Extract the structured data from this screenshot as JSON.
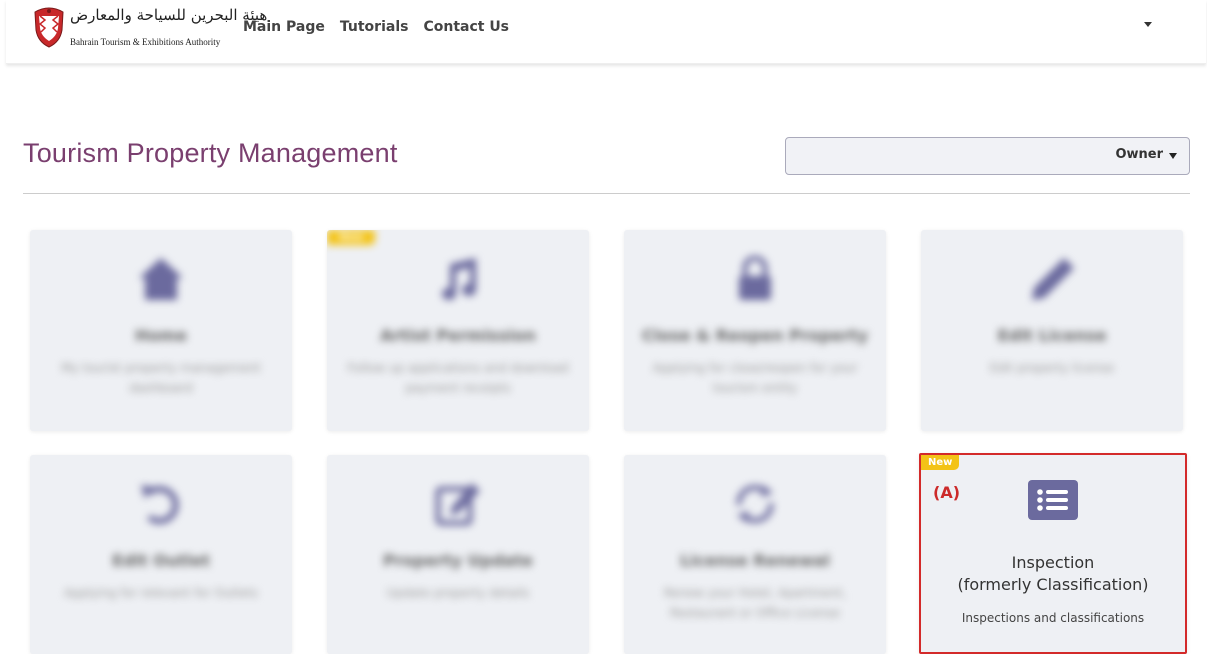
{
  "navbar": {
    "logo_arabic": "هيئة البحرين للسياحة والمعارض",
    "logo_english": "Bahrain Tourism & Exhibitions Authority",
    "links": [
      "Main Page",
      "Tutorials",
      "Contact Us"
    ]
  },
  "page": {
    "title": "Tourism Property Management",
    "role_selected": "Owner"
  },
  "cards": [
    {
      "title": "Home",
      "desc": "My tourist property management dashboard",
      "icon": "home-icon"
    },
    {
      "title": "Artist Permission",
      "desc": "Follow up applications and download payment receipts",
      "icon": "music-icon",
      "badge": "New"
    },
    {
      "title": "Close & Reopen Property",
      "desc": "Applying for close/reopen for your tourism entity",
      "icon": "lock-icon"
    },
    {
      "title": "Edit License",
      "desc": "Edit property license",
      "icon": "pencil-icon"
    },
    {
      "title": "Edit Outlet",
      "desc": "Applying for relevant for Outlets",
      "icon": "undo-icon"
    },
    {
      "title": "Property Update",
      "desc": "Update property details",
      "icon": "edit-icon"
    },
    {
      "title": "License Renewal",
      "desc": "Renew your Hotel, Apartment, Restaurant or Office License",
      "icon": "sync-icon"
    },
    {
      "title": "Inspection",
      "title_line2": "(formerly Classification)",
      "desc": "Inspections and classifications",
      "icon": "list-icon",
      "badge": "New",
      "marker": "(A)"
    }
  ],
  "colors": {
    "accent": "#7a3f6f",
    "icon": "#6b6a9e",
    "highlight_border": "#d32a2a",
    "badge": "#f3c316"
  }
}
